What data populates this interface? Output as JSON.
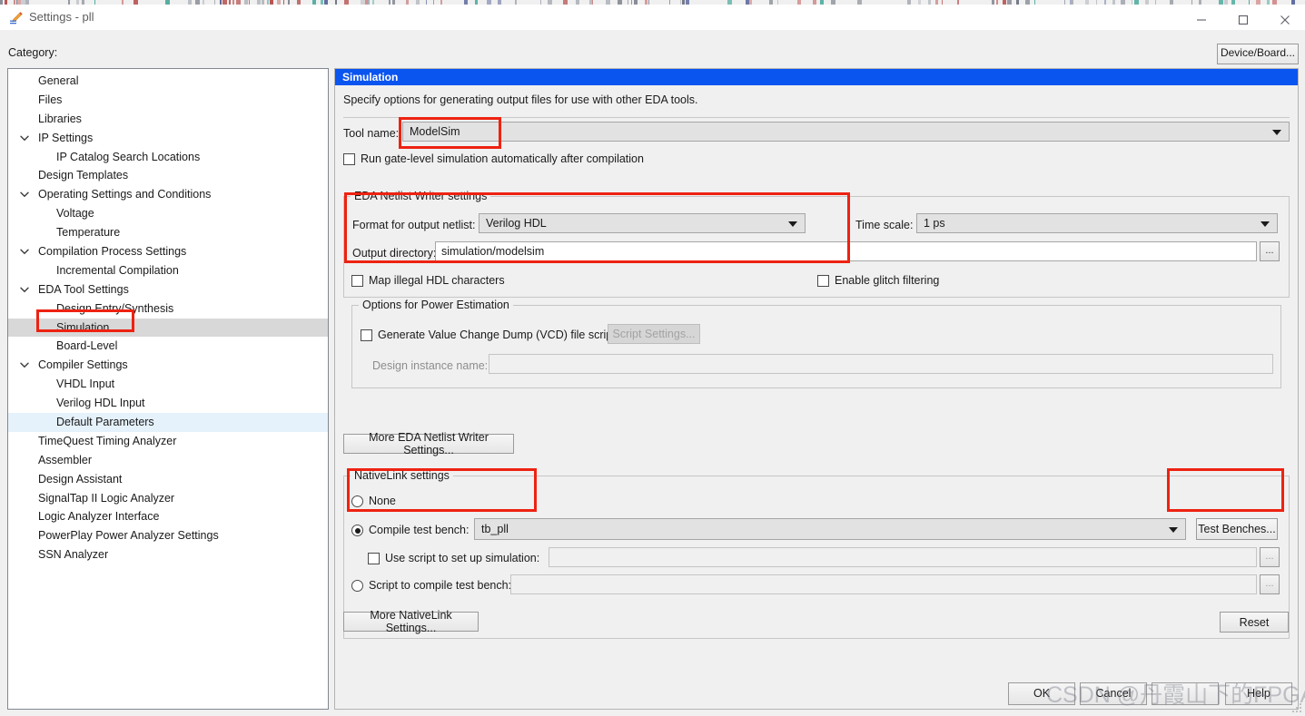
{
  "window": {
    "title": "Settings - pll",
    "icon": "pencil-settings-icon",
    "minimize": "─",
    "maximize": "□",
    "close": "✕"
  },
  "toolbar": {
    "category_label": "Category:",
    "device_board_label": "Device/Board..."
  },
  "sidebar": {
    "items": [
      {
        "label": "General",
        "indent": 0,
        "expander": false,
        "state": "normal"
      },
      {
        "label": "Files",
        "indent": 0,
        "expander": false,
        "state": "normal"
      },
      {
        "label": "Libraries",
        "indent": 0,
        "expander": false,
        "state": "normal"
      },
      {
        "label": "IP Settings",
        "indent": 0,
        "expander": true,
        "state": "normal"
      },
      {
        "label": "IP Catalog Search Locations",
        "indent": 1,
        "expander": false,
        "state": "normal"
      },
      {
        "label": "Design Templates",
        "indent": 0,
        "expander": false,
        "state": "normal"
      },
      {
        "label": "Operating Settings and Conditions",
        "indent": 0,
        "expander": true,
        "state": "normal"
      },
      {
        "label": "Voltage",
        "indent": 1,
        "expander": false,
        "state": "normal"
      },
      {
        "label": "Temperature",
        "indent": 1,
        "expander": false,
        "state": "normal"
      },
      {
        "label": "Compilation Process Settings",
        "indent": 0,
        "expander": true,
        "state": "normal"
      },
      {
        "label": "Incremental Compilation",
        "indent": 1,
        "expander": false,
        "state": "normal"
      },
      {
        "label": "EDA Tool Settings",
        "indent": 0,
        "expander": true,
        "state": "normal"
      },
      {
        "label": "Design Entry/Synthesis",
        "indent": 1,
        "expander": false,
        "state": "normal"
      },
      {
        "label": "Simulation",
        "indent": 1,
        "expander": false,
        "state": "selected"
      },
      {
        "label": "Board-Level",
        "indent": 1,
        "expander": false,
        "state": "normal"
      },
      {
        "label": "Compiler Settings",
        "indent": 0,
        "expander": true,
        "state": "normal"
      },
      {
        "label": "VHDL Input",
        "indent": 1,
        "expander": false,
        "state": "normal"
      },
      {
        "label": "Verilog HDL Input",
        "indent": 1,
        "expander": false,
        "state": "normal"
      },
      {
        "label": "Default Parameters",
        "indent": 1,
        "expander": false,
        "state": "highlighted"
      },
      {
        "label": "TimeQuest Timing Analyzer",
        "indent": 0,
        "expander": false,
        "state": "normal"
      },
      {
        "label": "Assembler",
        "indent": 0,
        "expander": false,
        "state": "normal"
      },
      {
        "label": "Design Assistant",
        "indent": 0,
        "expander": false,
        "state": "normal"
      },
      {
        "label": "SignalTap II Logic Analyzer",
        "indent": 0,
        "expander": false,
        "state": "normal"
      },
      {
        "label": "Logic Analyzer Interface",
        "indent": 0,
        "expander": false,
        "state": "normal"
      },
      {
        "label": "PowerPlay Power Analyzer Settings",
        "indent": 0,
        "expander": false,
        "state": "normal"
      },
      {
        "label": "SSN Analyzer",
        "indent": 0,
        "expander": false,
        "state": "normal"
      }
    ]
  },
  "panel": {
    "header": "Simulation",
    "description": "Specify options for generating output files for use with other EDA tools.",
    "tool_name_label": "Tool name:",
    "tool_name_value": "ModelSim",
    "run_gate_level_label": "Run gate-level simulation automatically after compilation",
    "run_gate_level_checked": false,
    "netlist_group": {
      "title": "EDA Netlist Writer settings",
      "format_label": "Format for output netlist:",
      "format_value": "Verilog HDL",
      "time_scale_label": "Time scale:",
      "time_scale_value": "1 ps",
      "output_dir_label": "Output directory:",
      "output_dir_value": "simulation/modelsim",
      "browse_label": "..."
    },
    "map_illegal_label": "Map illegal HDL characters",
    "map_illegal_checked": false,
    "glitch_label": "Enable glitch filtering",
    "glitch_checked": false,
    "power_group": {
      "title": "Options for Power Estimation",
      "vcd_label": "Generate Value Change Dump (VCD) file script",
      "vcd_checked": false,
      "script_settings_label": "Script Settings...",
      "design_instance_label": "Design instance name:",
      "design_instance_value": ""
    },
    "more_eda_label": "More EDA Netlist Writer Settings...",
    "nativelink_group": {
      "title": "NativeLink settings",
      "none_label": "None",
      "none_selected": false,
      "compile_tb_label": "Compile test bench:",
      "compile_tb_selected": true,
      "compile_tb_value": "tb_pll",
      "test_benches_label": "Test Benches...",
      "use_script_label": "Use script to set up simulation:",
      "use_script_checked": false,
      "use_script_value": "",
      "script_compile_label": "Script to compile test bench:",
      "script_compile_selected": false,
      "script_compile_value": "",
      "browse_label": "..."
    },
    "more_nativelink_label": "More NativeLink Settings...",
    "reset_label": "Reset"
  },
  "footer": {
    "ok_label": "OK",
    "cancel_label": "Cancel",
    "help_label": "Help",
    "watermark": "CSDN @丹霞山下的FPGA少年"
  },
  "annotations": [
    {
      "name": "tool-name-highlight"
    },
    {
      "name": "netlist-settings-highlight"
    },
    {
      "name": "simulation-tree-item-highlight"
    },
    {
      "name": "compile-test-bench-highlight"
    },
    {
      "name": "test-benches-highlight"
    }
  ],
  "colors": {
    "header_blue": "#0a54f0",
    "annotation_red": "#ee2211",
    "tree_selected": "#d8d8d8",
    "tree_highlight": "#e5f1fb"
  }
}
